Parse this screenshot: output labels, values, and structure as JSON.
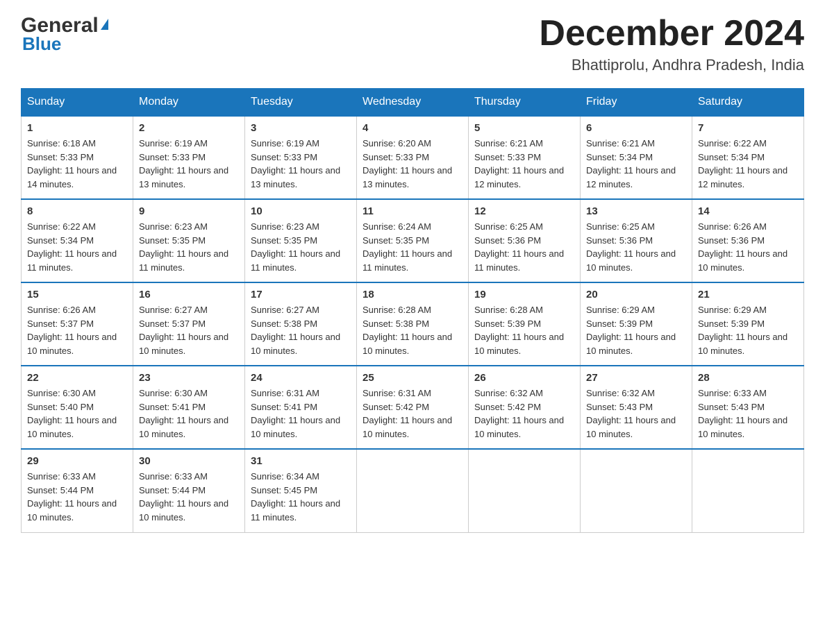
{
  "header": {
    "logo_general": "General",
    "logo_blue": "Blue",
    "month_year": "December 2024",
    "location": "Bhattiprolu, Andhra Pradesh, India"
  },
  "days_of_week": [
    "Sunday",
    "Monday",
    "Tuesday",
    "Wednesday",
    "Thursday",
    "Friday",
    "Saturday"
  ],
  "weeks": [
    [
      {
        "day": "1",
        "sunrise": "6:18 AM",
        "sunset": "5:33 PM",
        "daylight": "11 hours and 14 minutes."
      },
      {
        "day": "2",
        "sunrise": "6:19 AM",
        "sunset": "5:33 PM",
        "daylight": "11 hours and 13 minutes."
      },
      {
        "day": "3",
        "sunrise": "6:19 AM",
        "sunset": "5:33 PM",
        "daylight": "11 hours and 13 minutes."
      },
      {
        "day": "4",
        "sunrise": "6:20 AM",
        "sunset": "5:33 PM",
        "daylight": "11 hours and 13 minutes."
      },
      {
        "day": "5",
        "sunrise": "6:21 AM",
        "sunset": "5:33 PM",
        "daylight": "11 hours and 12 minutes."
      },
      {
        "day": "6",
        "sunrise": "6:21 AM",
        "sunset": "5:34 PM",
        "daylight": "11 hours and 12 minutes."
      },
      {
        "day": "7",
        "sunrise": "6:22 AM",
        "sunset": "5:34 PM",
        "daylight": "11 hours and 12 minutes."
      }
    ],
    [
      {
        "day": "8",
        "sunrise": "6:22 AM",
        "sunset": "5:34 PM",
        "daylight": "11 hours and 11 minutes."
      },
      {
        "day": "9",
        "sunrise": "6:23 AM",
        "sunset": "5:35 PM",
        "daylight": "11 hours and 11 minutes."
      },
      {
        "day": "10",
        "sunrise": "6:23 AM",
        "sunset": "5:35 PM",
        "daylight": "11 hours and 11 minutes."
      },
      {
        "day": "11",
        "sunrise": "6:24 AM",
        "sunset": "5:35 PM",
        "daylight": "11 hours and 11 minutes."
      },
      {
        "day": "12",
        "sunrise": "6:25 AM",
        "sunset": "5:36 PM",
        "daylight": "11 hours and 11 minutes."
      },
      {
        "day": "13",
        "sunrise": "6:25 AM",
        "sunset": "5:36 PM",
        "daylight": "11 hours and 10 minutes."
      },
      {
        "day": "14",
        "sunrise": "6:26 AM",
        "sunset": "5:36 PM",
        "daylight": "11 hours and 10 minutes."
      }
    ],
    [
      {
        "day": "15",
        "sunrise": "6:26 AM",
        "sunset": "5:37 PM",
        "daylight": "11 hours and 10 minutes."
      },
      {
        "day": "16",
        "sunrise": "6:27 AM",
        "sunset": "5:37 PM",
        "daylight": "11 hours and 10 minutes."
      },
      {
        "day": "17",
        "sunrise": "6:27 AM",
        "sunset": "5:38 PM",
        "daylight": "11 hours and 10 minutes."
      },
      {
        "day": "18",
        "sunrise": "6:28 AM",
        "sunset": "5:38 PM",
        "daylight": "11 hours and 10 minutes."
      },
      {
        "day": "19",
        "sunrise": "6:28 AM",
        "sunset": "5:39 PM",
        "daylight": "11 hours and 10 minutes."
      },
      {
        "day": "20",
        "sunrise": "6:29 AM",
        "sunset": "5:39 PM",
        "daylight": "11 hours and 10 minutes."
      },
      {
        "day": "21",
        "sunrise": "6:29 AM",
        "sunset": "5:39 PM",
        "daylight": "11 hours and 10 minutes."
      }
    ],
    [
      {
        "day": "22",
        "sunrise": "6:30 AM",
        "sunset": "5:40 PM",
        "daylight": "11 hours and 10 minutes."
      },
      {
        "day": "23",
        "sunrise": "6:30 AM",
        "sunset": "5:41 PM",
        "daylight": "11 hours and 10 minutes."
      },
      {
        "day": "24",
        "sunrise": "6:31 AM",
        "sunset": "5:41 PM",
        "daylight": "11 hours and 10 minutes."
      },
      {
        "day": "25",
        "sunrise": "6:31 AM",
        "sunset": "5:42 PM",
        "daylight": "11 hours and 10 minutes."
      },
      {
        "day": "26",
        "sunrise": "6:32 AM",
        "sunset": "5:42 PM",
        "daylight": "11 hours and 10 minutes."
      },
      {
        "day": "27",
        "sunrise": "6:32 AM",
        "sunset": "5:43 PM",
        "daylight": "11 hours and 10 minutes."
      },
      {
        "day": "28",
        "sunrise": "6:33 AM",
        "sunset": "5:43 PM",
        "daylight": "11 hours and 10 minutes."
      }
    ],
    [
      {
        "day": "29",
        "sunrise": "6:33 AM",
        "sunset": "5:44 PM",
        "daylight": "11 hours and 10 minutes."
      },
      {
        "day": "30",
        "sunrise": "6:33 AM",
        "sunset": "5:44 PM",
        "daylight": "11 hours and 10 minutes."
      },
      {
        "day": "31",
        "sunrise": "6:34 AM",
        "sunset": "5:45 PM",
        "daylight": "11 hours and 11 minutes."
      },
      null,
      null,
      null,
      null
    ]
  ]
}
